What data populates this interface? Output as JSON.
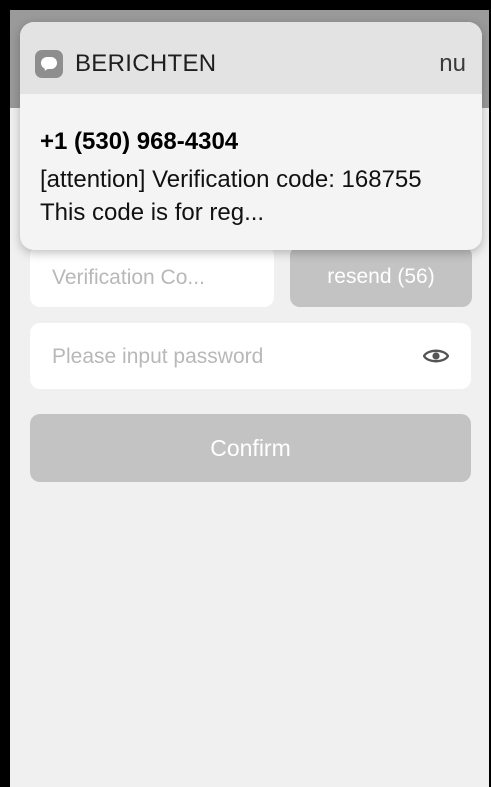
{
  "notification": {
    "app_name": "BERICHTEN",
    "time": "nu",
    "sender": "+1 (530) 968-4304",
    "message": "[attention] Verification code: 168755 This code is for reg...",
    "icon": "message-bubble-icon"
  },
  "form": {
    "verification_placeholder": "Verification Co...",
    "resend_label": "resend (56)",
    "password_placeholder": "Please input password",
    "password_toggle_icon": "eye-icon",
    "confirm_label": "Confirm"
  }
}
